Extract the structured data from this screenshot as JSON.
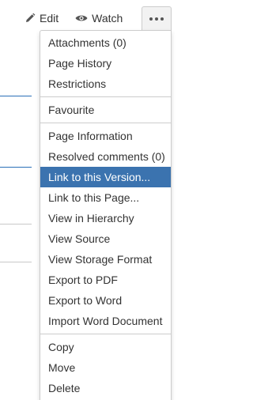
{
  "toolbar": {
    "edit_label": "Edit",
    "watch_label": "Watch"
  },
  "menu": {
    "groups": [
      {
        "items": [
          "Attachments (0)",
          "Page History",
          "Restrictions"
        ]
      },
      {
        "items": [
          "Favourite"
        ]
      },
      {
        "items": [
          "Page Information",
          "Resolved comments (0)",
          "Link to this Version...",
          "Link to this Page...",
          "View in Hierarchy",
          "View Source",
          "View Storage Format",
          "Export to PDF",
          "Export to Word",
          "Import Word Document"
        ]
      },
      {
        "items": [
          "Copy",
          "Move",
          "Delete"
        ]
      }
    ],
    "active_item": "Link to this Version..."
  },
  "colors": {
    "highlight": "#3b73af",
    "accent_line": "#2a6fb8"
  }
}
